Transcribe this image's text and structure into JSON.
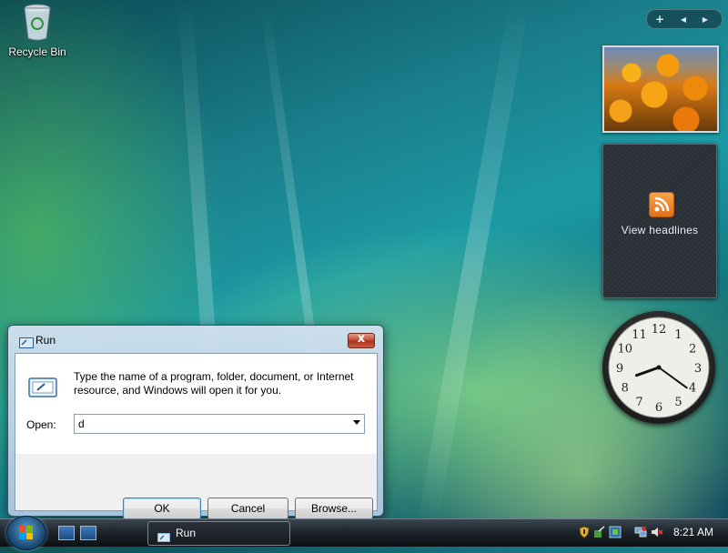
{
  "desktop": {
    "icons": [
      {
        "label": "Recycle Bin",
        "icon": "recycle-bin-icon"
      }
    ]
  },
  "sidebar": {
    "controls": {
      "add": "+",
      "prev": "◀",
      "next": "▶"
    },
    "feed_gadget": {
      "text": "View headlines",
      "icon": "rss-feed-icon"
    },
    "clock_gadget": {
      "numbers": [
        "12",
        "1",
        "2",
        "3",
        "4",
        "5",
        "6",
        "7",
        "8",
        "9",
        "10",
        "11"
      ],
      "hour": 8,
      "minute": 21
    }
  },
  "run_dialog": {
    "title": "Run",
    "close": "x",
    "description": "Type the name of a program, folder, document, or Internet resource, and Windows will open it for you.",
    "open_label": "Open:",
    "open_value": "d",
    "buttons": {
      "ok": "OK",
      "cancel": "Cancel",
      "browse": "Browse..."
    }
  },
  "taskbar": {
    "task_button_label": "Run",
    "clock": "8:21 AM"
  },
  "colors": {
    "accent": "#3c7fb1",
    "close": "#c24733"
  }
}
